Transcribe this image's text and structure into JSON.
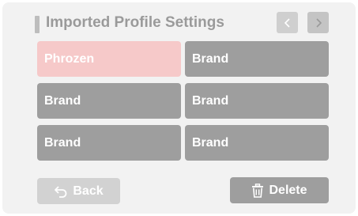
{
  "header": {
    "title": "Imported Profile Settings",
    "prev_icon": "chevron-left-icon",
    "next_icon": "chevron-right-icon"
  },
  "profiles": [
    {
      "label": "Phrozen",
      "selected": true
    },
    {
      "label": "Brand",
      "selected": false
    },
    {
      "label": "Brand",
      "selected": false
    },
    {
      "label": "Brand",
      "selected": false
    },
    {
      "label": "Brand",
      "selected": false
    },
    {
      "label": "Brand",
      "selected": false
    }
  ],
  "footer": {
    "back_label": "Back",
    "back_icon": "undo-arrow-icon",
    "delete_label": "Delete",
    "delete_icon": "trash-icon"
  },
  "colors": {
    "selected_tile": "#f6c9c9",
    "tile": "#9e9e9e",
    "panel": "#f2f2f2"
  }
}
